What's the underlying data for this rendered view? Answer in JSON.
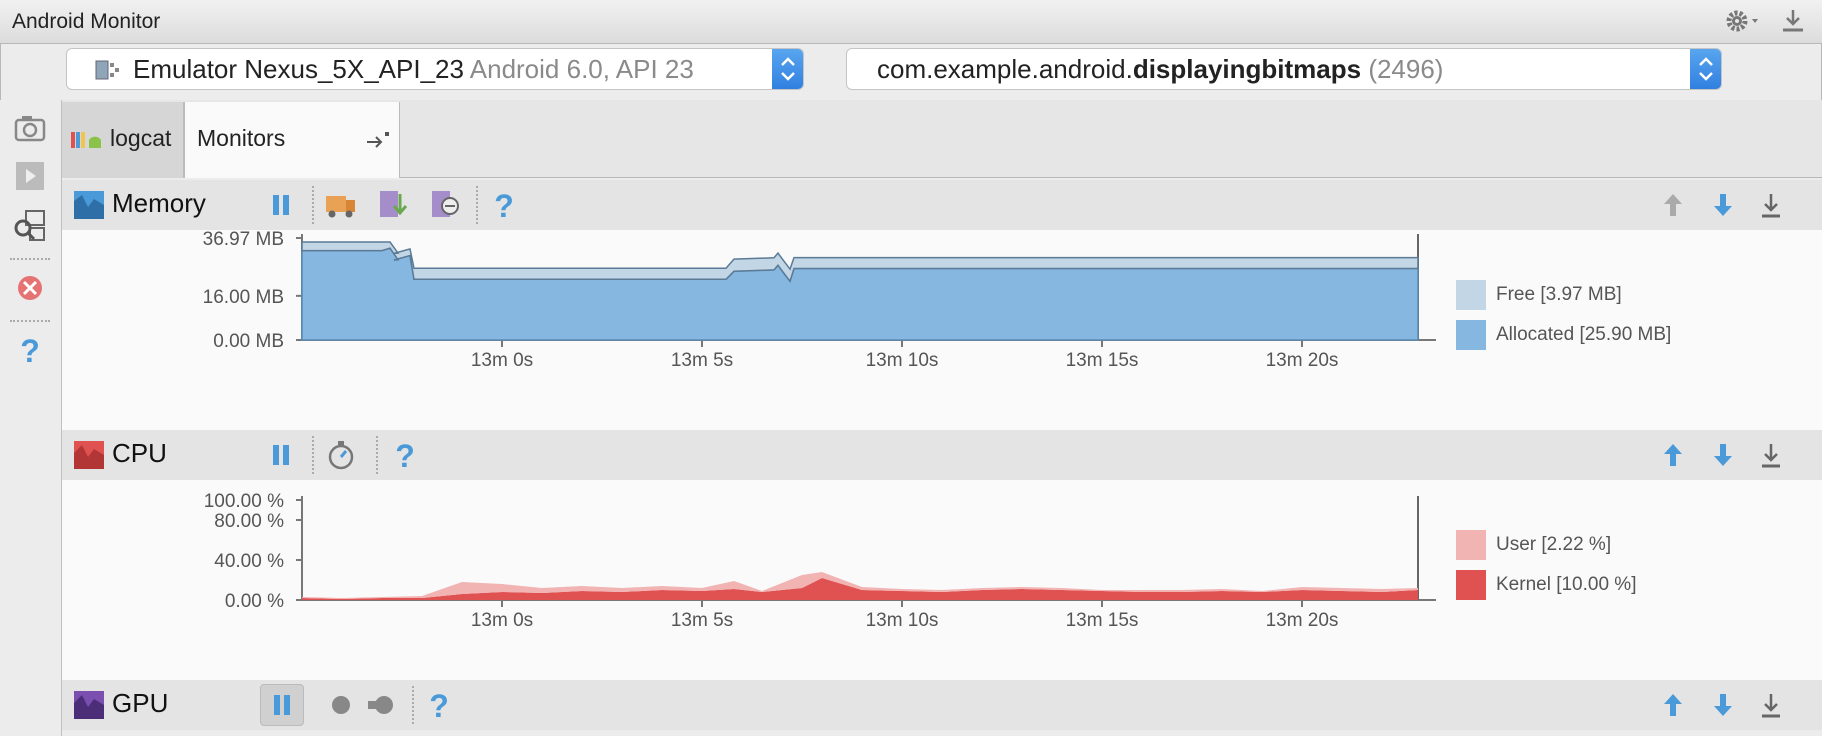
{
  "window": {
    "title": "Android Monitor"
  },
  "device_selector": {
    "device": "Emulator Nexus_5X_API_23",
    "os": "Android 6.0, API 23"
  },
  "process_selector": {
    "package_prefix": "com.example.android.",
    "package_name": "displayingbitmaps",
    "pid": "(2496)"
  },
  "tabs": [
    {
      "label": "logcat"
    },
    {
      "label": "Monitors"
    }
  ],
  "colors": {
    "memory_free": "#c3d6e6",
    "memory_allocated": "#86b7e0",
    "cpu_user": "#f2b3b3",
    "cpu_kernel": "#e05252",
    "accent_blue": "#4a9ad9"
  },
  "memory": {
    "label": "Memory",
    "chart_data": {
      "type": "area",
      "y_ticks": [
        "36.97 MB",
        "16.00 MB",
        "0.00 MB"
      ],
      "x_ticks": [
        "13m 0s",
        "13m 5s",
        "13m 10s",
        "13m 15s",
        "13m 20s"
      ],
      "ylim": [
        0,
        36.97
      ],
      "xlim": [
        -5.0,
        22.9
      ],
      "x": [
        -5.0,
        -3.0,
        -2.8,
        -2.6,
        -2.7,
        -2.3,
        -2.2,
        5.6,
        5.8,
        6.8,
        6.9,
        7.0,
        7.2,
        7.3,
        22.9
      ],
      "series": [
        {
          "name": "Allocated [25.90 MB]",
          "values": [
            32.4,
            32.4,
            33.3,
            29.1,
            29.0,
            30.6,
            22.0,
            22.0,
            24.9,
            25.4,
            27.1,
            25.1,
            21.3,
            25.9,
            25.9
          ]
        },
        {
          "name": "Free [3.97 MB]",
          "values": [
            3.1,
            3.1,
            2.2,
            2.4,
            2.4,
            2.4,
            4.0,
            4.0,
            4.4,
            4.4,
            4.4,
            4.4,
            4.4,
            3.97,
            3.97
          ]
        }
      ],
      "legend_position": "right"
    }
  },
  "cpu": {
    "label": "CPU",
    "chart_data": {
      "type": "area",
      "y_ticks": [
        "100.00 %",
        "80.00 %",
        "40.00 %",
        "0.00 %"
      ],
      "y_tick_values": [
        100,
        80,
        40,
        0
      ],
      "x_ticks": [
        "13m 0s",
        "13m 5s",
        "13m 10s",
        "13m 15s",
        "13m 20s"
      ],
      "ylim": [
        0,
        100
      ],
      "xlim": [
        -5.0,
        22.9
      ],
      "x": [
        -5.0,
        -4.0,
        -3.0,
        -2.0,
        -1.0,
        0,
        1,
        2,
        3,
        4,
        5,
        5.8,
        6.5,
        7.5,
        8.0,
        9,
        10,
        11,
        12,
        13,
        14,
        15,
        16,
        17,
        18,
        19,
        20,
        21,
        22,
        22.9
      ],
      "series": [
        {
          "name": "Kernel [10.00 %]",
          "values": [
            2,
            1,
            2,
            2,
            6,
            8,
            7,
            9,
            8,
            10,
            9,
            11,
            8,
            12,
            22,
            10,
            9,
            8,
            10,
            11,
            10,
            9,
            8,
            8,
            9,
            8,
            10,
            9,
            8,
            10
          ]
        },
        {
          "name": "User [2.22 %]",
          "values": [
            1,
            1,
            1,
            2,
            12,
            8,
            5,
            5,
            4,
            4,
            3,
            8,
            1,
            13,
            6,
            3,
            2,
            2,
            2,
            2,
            2,
            1,
            2,
            2,
            2,
            1,
            3,
            3,
            3,
            2
          ]
        }
      ],
      "legend_position": "right"
    }
  },
  "gpu": {
    "label": "GPU"
  }
}
